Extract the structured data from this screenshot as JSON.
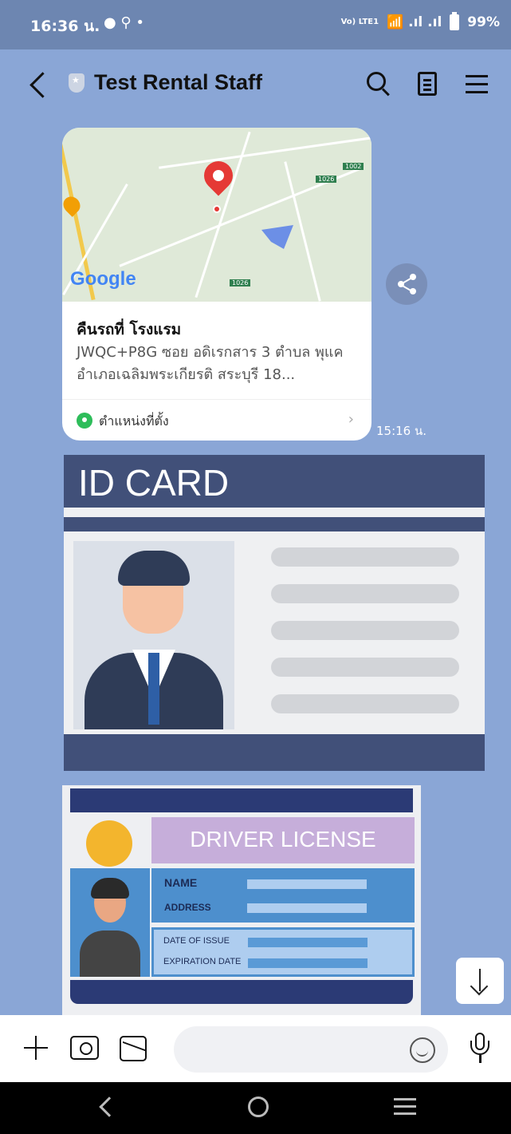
{
  "status_bar": {
    "time": "16:36 น.",
    "left_icons": "● ⚲ •",
    "volte": "Vo) LTE1",
    "signal": "📶 .ıl .ıl",
    "battery": "99%"
  },
  "header": {
    "title": "Test Rental Staff"
  },
  "location_message": {
    "map_logo": "Google",
    "map_road_label_1": "1002",
    "map_road_label_2": "1026",
    "map_road_label_3": "1026",
    "title": "คืนรถที่ โรงแรม",
    "address": "JWQC+P8G ซอย อดิเรกสาร 3 ตำบล พุแค อำเภอเฉลิมพระเกียรติ สระบุรี 18...",
    "footer_label": "ตำแหน่งที่ตั้ง",
    "time": "15:16 น."
  },
  "id_card_image": {
    "title": "ID CARD"
  },
  "driver_license_image": {
    "title": "DRIVER LICENSE",
    "name_label": "NAME",
    "address_label": "ADDRESS",
    "issue_label": "DATE OF ISSUE",
    "expiry_label": "EXPIRATION DATE"
  },
  "input": {
    "placeholder": ""
  }
}
